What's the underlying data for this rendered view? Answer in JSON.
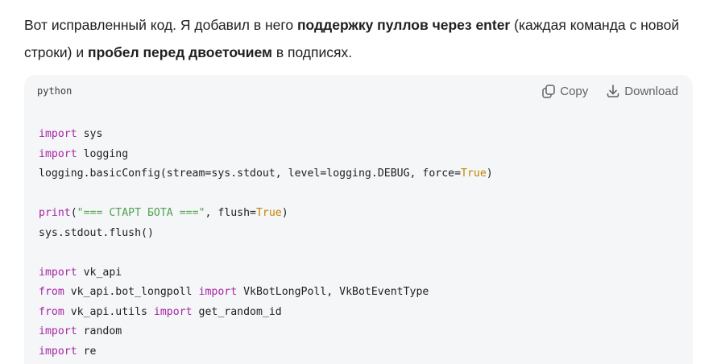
{
  "message": {
    "part1": "Вот исправленный код. Я добавил в него ",
    "bold1": "поддержку пуллов через enter",
    "part2": " (каждая команда с новой строки) и ",
    "bold2": "пробел перед двоеточием",
    "part3": " в подписях."
  },
  "code_block": {
    "language": "python",
    "copy_label": "Copy",
    "download_label": "Download",
    "icons": {
      "copy": "copy-icon",
      "download": "download-icon"
    },
    "colors": {
      "keyword": "#a626a4",
      "string": "#50a14f",
      "literal": "#c18401",
      "background": "#f5f6f8"
    },
    "lines": [
      [
        {
          "t": "kw",
          "v": "import"
        },
        {
          "t": "",
          "v": " sys"
        }
      ],
      [
        {
          "t": "kw",
          "v": "import"
        },
        {
          "t": "",
          "v": " logging"
        }
      ],
      [
        {
          "t": "",
          "v": "logging.basicConfig(stream="
        },
        {
          "t": "",
          "v": "sys.stdout, level="
        },
        {
          "t": "",
          "v": "logging.DEBUG, force="
        },
        {
          "t": "lit",
          "v": "True"
        },
        {
          "t": "",
          "v": ")"
        }
      ],
      [],
      [
        {
          "t": "kw",
          "v": "print"
        },
        {
          "t": "",
          "v": "("
        },
        {
          "t": "str",
          "v": "\"=== СТАРТ БОТА ===\""
        },
        {
          "t": "",
          "v": ", flush="
        },
        {
          "t": "lit",
          "v": "True"
        },
        {
          "t": "",
          "v": ")"
        }
      ],
      [
        {
          "t": "",
          "v": "sys.stdout.flush()"
        }
      ],
      [],
      [
        {
          "t": "kw",
          "v": "import"
        },
        {
          "t": "",
          "v": " vk_api"
        }
      ],
      [
        {
          "t": "kw",
          "v": "from"
        },
        {
          "t": "",
          "v": " vk_api.bot_longpoll "
        },
        {
          "t": "kw",
          "v": "import"
        },
        {
          "t": "",
          "v": " VkBotLongPoll, VkBotEventType"
        }
      ],
      [
        {
          "t": "kw",
          "v": "from"
        },
        {
          "t": "",
          "v": " vk_api.utils "
        },
        {
          "t": "kw",
          "v": "import"
        },
        {
          "t": "",
          "v": " get_random_id"
        }
      ],
      [
        {
          "t": "kw",
          "v": "import"
        },
        {
          "t": "",
          "v": " random"
        }
      ],
      [
        {
          "t": "kw",
          "v": "import"
        },
        {
          "t": "",
          "v": " re"
        }
      ]
    ]
  }
}
